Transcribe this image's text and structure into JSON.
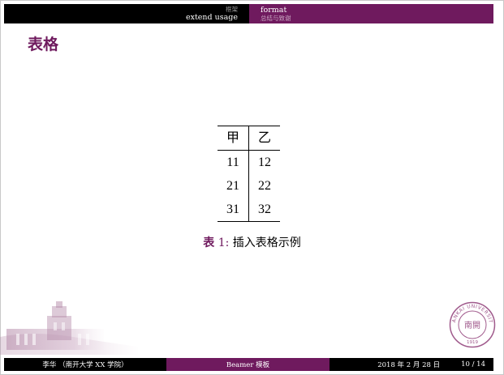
{
  "header": {
    "left": {
      "section": "框架",
      "subsection": "extend usage"
    },
    "right": {
      "section": "format",
      "subsection": "总结与致谢"
    }
  },
  "frame_title": "表格",
  "table": {
    "columns": [
      "甲",
      "乙"
    ],
    "rows": [
      [
        "11",
        "12"
      ],
      [
        "21",
        "22"
      ],
      [
        "31",
        "32"
      ]
    ]
  },
  "caption": {
    "label": "表",
    "number": "1:",
    "text": "插入表格示例"
  },
  "seal": {
    "text": "NANKAI UNIVERSITY",
    "year": "1919",
    "center": "南開"
  },
  "footer": {
    "author": "李华 （南开大学 XX 学院）",
    "title": "Beamer 模板",
    "date": "2018 年 2 月 28 日",
    "page": "10 / 14"
  },
  "colors": {
    "accent": "#6f1a5e",
    "bar_dark": "#000000"
  }
}
